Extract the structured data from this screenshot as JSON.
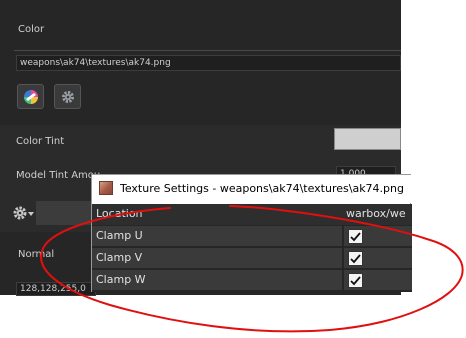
{
  "panel": {
    "color_section_label": "Color",
    "texture_path": "weapons\\ak74\\textures\\ak74.png",
    "color_tint_label": "Color Tint",
    "model_tint_label": "Model Tint Amou",
    "model_tint_value": "1.000",
    "normal_label": "Normal",
    "normal_value": "128,128,255,0",
    "icons": {
      "texture_picker": "texture-picker-icon",
      "texture_settings": "gear-icon",
      "section_menu": "gear-dropdown-icon"
    },
    "tint_color": "#cfcfcf"
  },
  "dialog": {
    "title": "Texture Settings - weapons\\ak74\\textures\\ak74.png",
    "columns": [
      "Location",
      "warbox/we"
    ],
    "rows": [
      {
        "label": "Clamp U",
        "checked": true
      },
      {
        "label": "Clamp V",
        "checked": true
      },
      {
        "label": "Clamp W",
        "checked": true
      }
    ]
  },
  "annotation": {
    "color": "#e01010"
  }
}
